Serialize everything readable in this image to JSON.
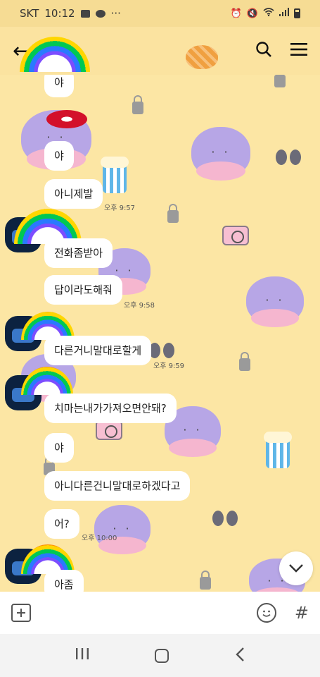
{
  "status_bar": {
    "carrier": "SKT",
    "time": "10:12",
    "more": "···"
  },
  "header": {
    "back": "←"
  },
  "messages": [
    {
      "text": "야"
    },
    {
      "text": "야"
    },
    {
      "text": "아니제발",
      "time": "오후 9:57"
    },
    {
      "text": "전화좀받아"
    },
    {
      "text": "답이라도해줘",
      "time": "오후 9:58"
    },
    {
      "text": "다른거니말대로할게",
      "time": "오후 9:59"
    },
    {
      "text": "치마는내가가져오면안돼?"
    },
    {
      "text": "야"
    },
    {
      "text": "아니다른건니말대로하겠다고"
    },
    {
      "text": "어?",
      "time": "오후 10:00"
    },
    {
      "text": "아좀"
    }
  ],
  "input_bar": {
    "hash": "#"
  },
  "icons": {
    "back": "arrow-left-icon",
    "search": "search-icon",
    "menu": "hamburger-menu-icon",
    "add": "plus-icon",
    "emoji": "emoji-icon",
    "scroll_down": "chevron-down-icon"
  },
  "colors": {
    "background": "#fce6a4",
    "header": "#fbe3a0",
    "bubble": "#ffffff"
  }
}
